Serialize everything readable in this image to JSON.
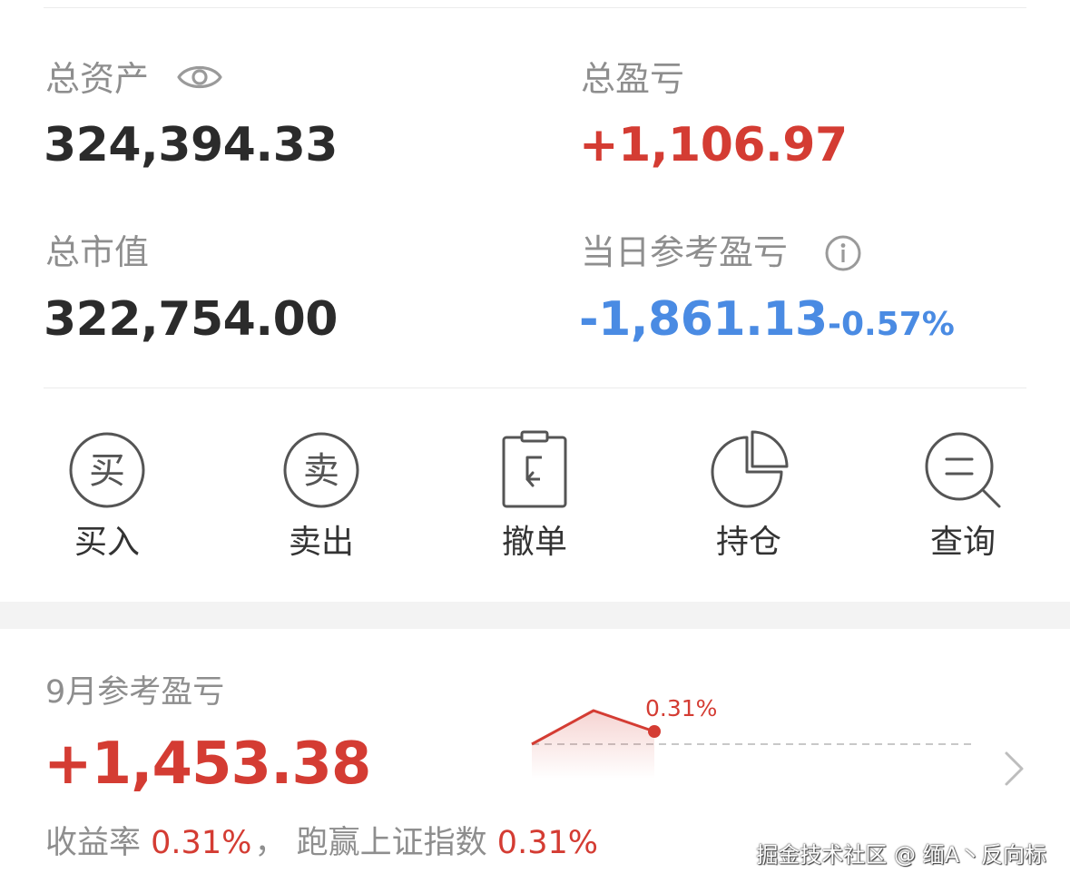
{
  "summary": {
    "total_assets_label": "总资产",
    "total_assets_value": "324,394.33",
    "total_pnl_label": "总盈亏",
    "total_pnl_value": "+1,106.97",
    "market_value_label": "总市值",
    "market_value_value": "322,754.00",
    "daily_pnl_label": "当日参考盈亏",
    "daily_pnl_value": "-1,861.13",
    "daily_pnl_pct": "-0.57%"
  },
  "actions": [
    {
      "label": "买入",
      "glyph": "买",
      "icon": "buy-circle-icon"
    },
    {
      "label": "卖出",
      "glyph": "卖",
      "icon": "sell-circle-icon"
    },
    {
      "label": "撤单",
      "icon": "clipboard-undo-icon"
    },
    {
      "label": "持仓",
      "icon": "pie-chart-icon"
    },
    {
      "label": "查询",
      "icon": "search-list-icon"
    }
  ],
  "monthly": {
    "title": "9月参考盈亏",
    "value": "+1,453.38",
    "yield_label": "收益率",
    "yield_value": "0.31%",
    "separator": "，",
    "benchmark_label": "跑赢上证指数",
    "benchmark_value": "0.31%",
    "chart_point_label": "0.31%"
  },
  "watermark": "掘金技术社区 @ 缅A丶反向标",
  "colors": {
    "red": "#d43c33",
    "blue": "#4a8be3",
    "gray_text": "#8e8e8e",
    "dark_text": "#2b2b2b"
  }
}
